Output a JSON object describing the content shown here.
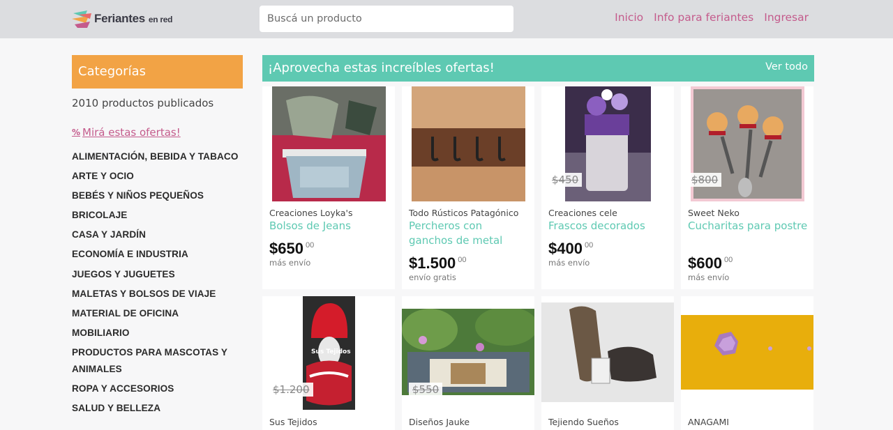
{
  "header": {
    "logo_main": "Feriantes",
    "logo_small": "en red",
    "search_placeholder": "Buscá un producto",
    "nav": [
      "Inicio",
      "Info para feriantes",
      "Ingresar"
    ]
  },
  "sidebar": {
    "title": "Categorías",
    "count": "2010 productos publicados",
    "offers_label": "Mirá estas ofertas!",
    "categories": [
      "ALIMENTACIÓN, BEBIDA Y TABACO",
      "ARTE Y OCIO",
      "BEBÉS Y NIÑOS PEQUEÑOS",
      "BRICOLAJE",
      "CASA Y JARDÍN",
      "ECONOMÍA E INDUSTRIA",
      "JUEGOS Y JUGUETES",
      "MALETAS Y BOLSOS DE VIAJE",
      "MATERIAL DE OFICINA",
      "MOBILIARIO",
      "PRODUCTOS PARA MASCOTAS Y ANIMALES",
      "ROPA Y ACCESORIOS",
      "SALUD Y BELLEZA"
    ]
  },
  "offers": {
    "title": "¡Aprovecha estas increíbles ofertas!",
    "see_all": "Ver todo",
    "products": [
      {
        "seller": "Creaciones Loyka's",
        "name": "Bolsos de Jeans",
        "price": "$650",
        "cents": "00",
        "shipping": "más envío",
        "old_price": ""
      },
      {
        "seller": "Todo Rústicos Patagónico",
        "name": "Percheros con ganchos de metal",
        "price": "$1.500",
        "cents": "00",
        "shipping": "envío gratis",
        "old_price": ""
      },
      {
        "seller": "Creaciones cele",
        "name": "Frascos decorados",
        "price": "$400",
        "cents": "00",
        "shipping": "más envío",
        "old_price": "$450"
      },
      {
        "seller": "Sweet Neko",
        "name": "Cucharitas para postre",
        "price": "$600",
        "cents": "00",
        "shipping": "más envío",
        "old_price": "$800"
      },
      {
        "seller": "Sus Tejidos",
        "old_price": "$1.200",
        "image_text": "Sus Tejidos"
      },
      {
        "seller": "Diseños Jauke",
        "old_price": "$550"
      },
      {
        "seller": "Tejiendo Sueños"
      },
      {
        "seller": "ANAGAMI"
      }
    ]
  },
  "colors": {
    "header_bg": "#dcdde0",
    "nav_link": "#c45b8c",
    "categories_bg": "#f2a345",
    "banner_bg": "#5ec9b2",
    "product_name": "#5ec9b2"
  }
}
